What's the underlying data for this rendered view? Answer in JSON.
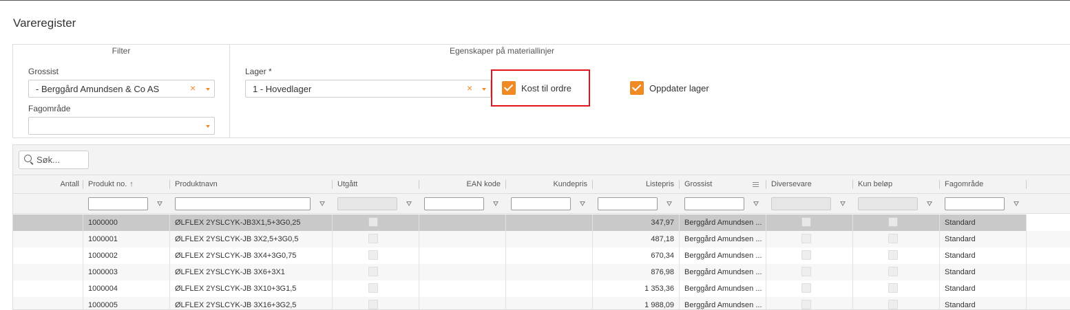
{
  "page": {
    "title": "Vareregister"
  },
  "filter": {
    "title": "Filter",
    "grossist_label": "Grossist",
    "grossist_value": "- Berggård Amundsen & Co AS",
    "fagomrade_label": "Fagområde",
    "fagomrade_value": ""
  },
  "props": {
    "title": "Egenskaper på materiallinjer",
    "lager_label": "Lager *",
    "lager_value": "1 - Hovedlager",
    "kost_label": "Kost til ordre",
    "kost_checked": true,
    "oppdater_label": "Oppdater lager",
    "oppdater_checked": true
  },
  "grid": {
    "search_placeholder": "Søk...",
    "sort_indicator": "↑",
    "columns": [
      "Antall",
      "Produkt no.",
      "Produktnavn",
      "Utgått",
      "EAN kode",
      "Kundepris",
      "Listepris",
      "Grossist",
      "Diversevare",
      "Kun beløp",
      "Fagområde"
    ],
    "rows": [
      {
        "produkt_no": "1000000",
        "navn": "ØLFLEX 2YSLCYK-JB3X1,5+3G0,25",
        "listepris": "347,97",
        "grossist": "Berggård Amundsen ...",
        "fagomrade": "Standard"
      },
      {
        "produkt_no": "1000001",
        "navn": "ØLFLEX 2YSLCYK-JB 3X2,5+3G0,5",
        "listepris": "487,18",
        "grossist": "Berggård Amundsen ...",
        "fagomrade": "Standard"
      },
      {
        "produkt_no": "1000002",
        "navn": "ØLFLEX 2YSLCYK-JB 3X4+3G0,75",
        "listepris": "670,34",
        "grossist": "Berggård Amundsen ...",
        "fagomrade": "Standard"
      },
      {
        "produkt_no": "1000003",
        "navn": "ØLFLEX 2YSLCYK-JB 3X6+3X1",
        "listepris": "876,98",
        "grossist": "Berggård Amundsen ...",
        "fagomrade": "Standard"
      },
      {
        "produkt_no": "1000004",
        "navn": "ØLFLEX 2YSLCYK-JB 3X10+3G1,5",
        "listepris": "1 353,36",
        "grossist": "Berggård Amundsen ...",
        "fagomrade": "Standard"
      },
      {
        "produkt_no": "1000005",
        "navn": "ØLFLEX 2YSLCYK-JB 3X16+3G2,5",
        "listepris": "1 988,09",
        "grossist": "Berggård Amundsen ...",
        "fagomrade": "Standard"
      }
    ]
  },
  "colors": {
    "accent": "#f08a24",
    "highlight": "#e2141b",
    "selected_row": "#c9c9c9"
  }
}
